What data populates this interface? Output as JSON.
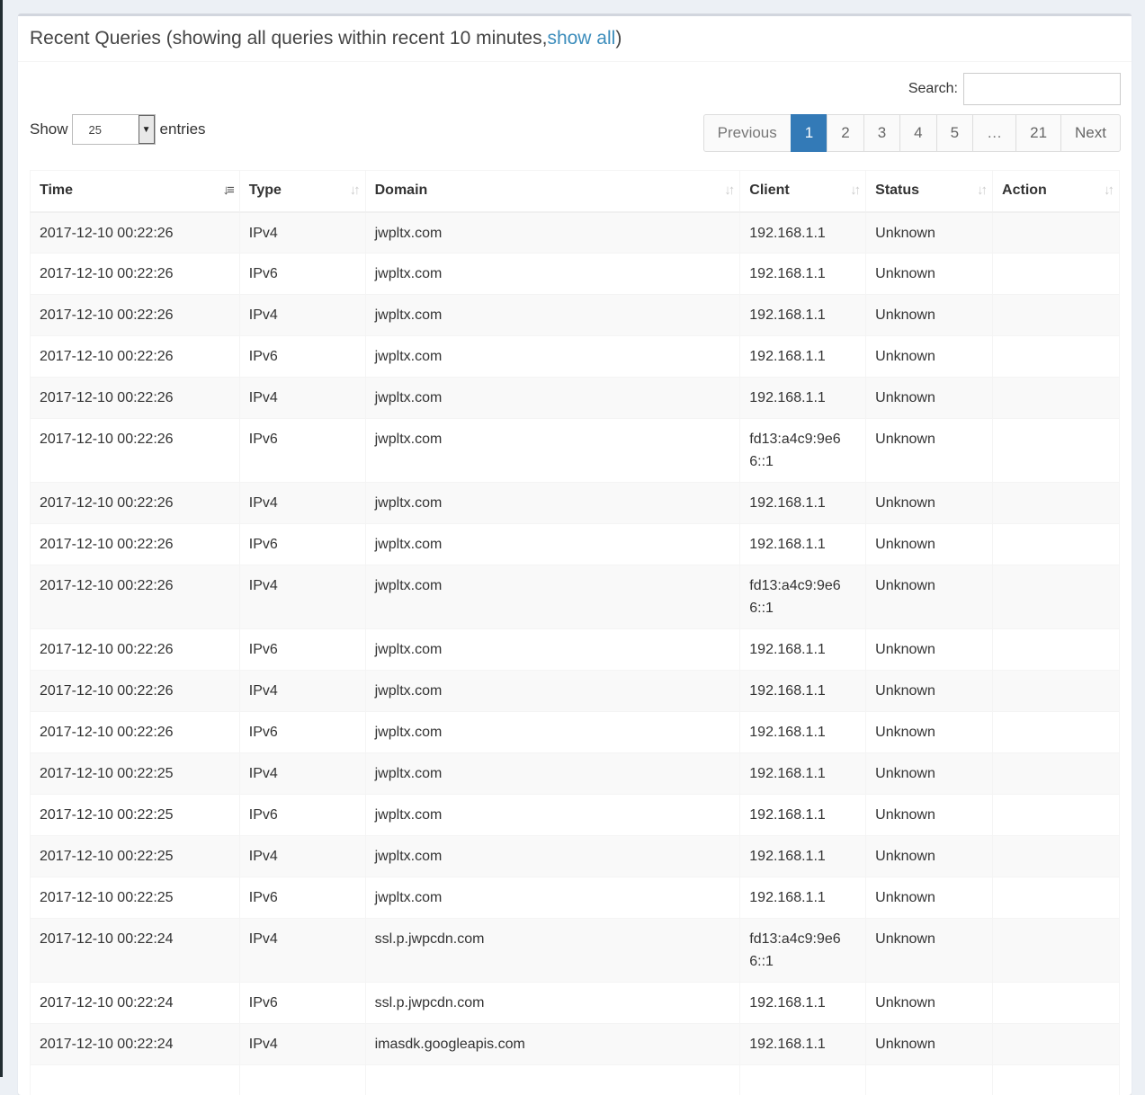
{
  "header": {
    "title_prefix": "Recent Queries (showing all queries within recent 10 minutes, ",
    "show_all_link": "show all",
    "title_suffix": ")"
  },
  "search": {
    "label": "Search:",
    "value": ""
  },
  "length": {
    "show_label": "Show",
    "value": "25",
    "entries_label": "entries"
  },
  "pagination": {
    "previous": "Previous",
    "pages": [
      "1",
      "2",
      "3",
      "4",
      "5",
      "…",
      "21"
    ],
    "next": "Next",
    "active": "1"
  },
  "table": {
    "columns": [
      "Time",
      "Type",
      "Domain",
      "Client",
      "Status",
      "Action"
    ],
    "rows": [
      {
        "time": "2017-12-10 00:22:26",
        "type": "IPv4",
        "domain": "jwpltx.com",
        "client": "192.168.1.1",
        "status": "Unknown",
        "action": ""
      },
      {
        "time": "2017-12-10 00:22:26",
        "type": "IPv6",
        "domain": "jwpltx.com",
        "client": "192.168.1.1",
        "status": "Unknown",
        "action": ""
      },
      {
        "time": "2017-12-10 00:22:26",
        "type": "IPv4",
        "domain": "jwpltx.com",
        "client": "192.168.1.1",
        "status": "Unknown",
        "action": ""
      },
      {
        "time": "2017-12-10 00:22:26",
        "type": "IPv6",
        "domain": "jwpltx.com",
        "client": "192.168.1.1",
        "status": "Unknown",
        "action": ""
      },
      {
        "time": "2017-12-10 00:22:26",
        "type": "IPv4",
        "domain": "jwpltx.com",
        "client": "192.168.1.1",
        "status": "Unknown",
        "action": ""
      },
      {
        "time": "2017-12-10 00:22:26",
        "type": "IPv6",
        "domain": "jwpltx.com",
        "client": "fd13:a4c9:9e66::1",
        "status": "Unknown",
        "action": ""
      },
      {
        "time": "2017-12-10 00:22:26",
        "type": "IPv4",
        "domain": "jwpltx.com",
        "client": "192.168.1.1",
        "status": "Unknown",
        "action": ""
      },
      {
        "time": "2017-12-10 00:22:26",
        "type": "IPv6",
        "domain": "jwpltx.com",
        "client": "192.168.1.1",
        "status": "Unknown",
        "action": ""
      },
      {
        "time": "2017-12-10 00:22:26",
        "type": "IPv4",
        "domain": "jwpltx.com",
        "client": "fd13:a4c9:9e66::1",
        "status": "Unknown",
        "action": ""
      },
      {
        "time": "2017-12-10 00:22:26",
        "type": "IPv6",
        "domain": "jwpltx.com",
        "client": "192.168.1.1",
        "status": "Unknown",
        "action": ""
      },
      {
        "time": "2017-12-10 00:22:26",
        "type": "IPv4",
        "domain": "jwpltx.com",
        "client": "192.168.1.1",
        "status": "Unknown",
        "action": ""
      },
      {
        "time": "2017-12-10 00:22:26",
        "type": "IPv6",
        "domain": "jwpltx.com",
        "client": "192.168.1.1",
        "status": "Unknown",
        "action": ""
      },
      {
        "time": "2017-12-10 00:22:25",
        "type": "IPv4",
        "domain": "jwpltx.com",
        "client": "192.168.1.1",
        "status": "Unknown",
        "action": ""
      },
      {
        "time": "2017-12-10 00:22:25",
        "type": "IPv6",
        "domain": "jwpltx.com",
        "client": "192.168.1.1",
        "status": "Unknown",
        "action": ""
      },
      {
        "time": "2017-12-10 00:22:25",
        "type": "IPv4",
        "domain": "jwpltx.com",
        "client": "192.168.1.1",
        "status": "Unknown",
        "action": ""
      },
      {
        "time": "2017-12-10 00:22:25",
        "type": "IPv6",
        "domain": "jwpltx.com",
        "client": "192.168.1.1",
        "status": "Unknown",
        "action": ""
      },
      {
        "time": "2017-12-10 00:22:24",
        "type": "IPv4",
        "domain": "ssl.p.jwpcdn.com",
        "client": "fd13:a4c9:9e66::1",
        "status": "Unknown",
        "action": ""
      },
      {
        "time": "2017-12-10 00:22:24",
        "type": "IPv6",
        "domain": "ssl.p.jwpcdn.com",
        "client": "192.168.1.1",
        "status": "Unknown",
        "action": ""
      },
      {
        "time": "2017-12-10 00:22:24",
        "type": "IPv4",
        "domain": "imasdk.googleapis.com",
        "client": "192.168.1.1",
        "status": "Unknown",
        "action": ""
      },
      {
        "time": "",
        "type": "",
        "domain": "",
        "client": "",
        "status": "",
        "action": ""
      }
    ]
  },
  "icons": {
    "sort_active": "sort-amount-desc-icon",
    "sort_inactive": "sort-both-icon",
    "select_arrow": "caret-down-icon"
  },
  "colors": {
    "link": "#3c8dbc",
    "active_page": "#337ab7",
    "stripe": "#f9f9f9"
  }
}
